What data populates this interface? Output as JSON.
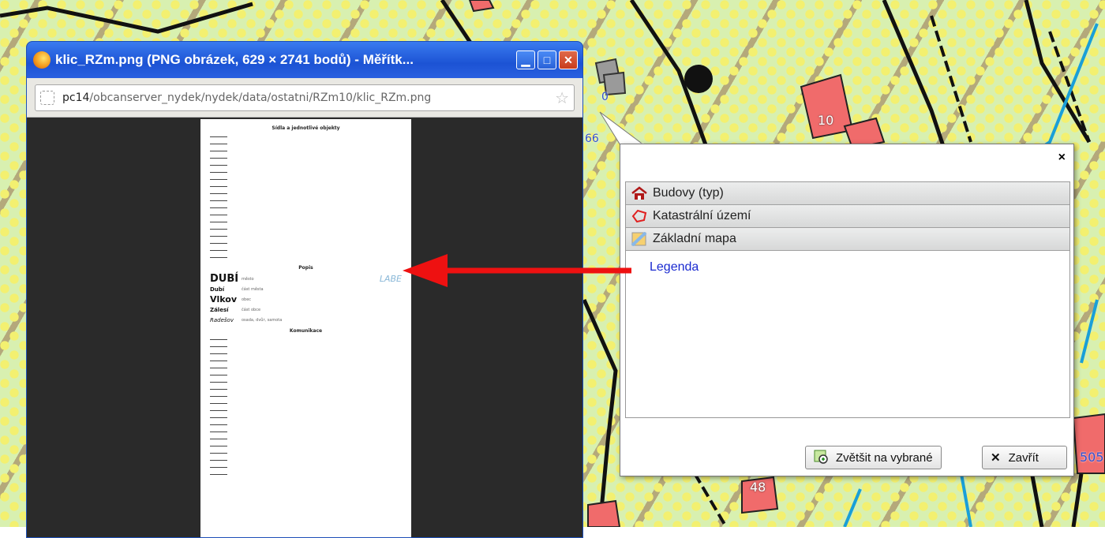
{
  "browser": {
    "title": "klic_RZm.png (PNG obrázek, 629 × 2741 bodů) - Měřítk...",
    "url_host": "pc14",
    "url_path": "/obcanserver_nydek/nydek/data/ostatni/RZm10/klic_RZm.png",
    "icons": [
      "firefox-icon",
      "minimize-icon",
      "maximize-icon",
      "close-icon",
      "page-icon",
      "bookmark-star-icon"
    ]
  },
  "legend_image": {
    "section1": "Sídla a jednotlivé objekty",
    "section2": "Popis",
    "section3": "Komunikace",
    "popis_rows": [
      {
        "name": "DUBÍ",
        "desc": "město"
      },
      {
        "name": "Dubí",
        "desc": "část města"
      },
      {
        "name": "Vlkov",
        "desc": "obec"
      },
      {
        "name": "Zálesí",
        "desc": "část obce"
      },
      {
        "name": "Radešov",
        "desc": "osada, dvůr, samota"
      }
    ],
    "water_label": "LABE"
  },
  "map_labels": [
    "10",
    "48",
    "505",
    "0",
    "66"
  ],
  "popup": {
    "close": "×",
    "layers": [
      {
        "label": "Budovy (typ)",
        "icon": "house-icon"
      },
      {
        "label": "Katastrální území",
        "icon": "polygon-icon"
      },
      {
        "label": "Základní mapa",
        "icon": "map-icon"
      }
    ],
    "legend_link": "Legenda",
    "zoom_button": "Zvětšit na vybrané",
    "close_button": "Zavřít"
  },
  "colors": {
    "arrow": "#ee1111",
    "link": "#1a2ad0",
    "titlebar": "#2a60e0"
  }
}
